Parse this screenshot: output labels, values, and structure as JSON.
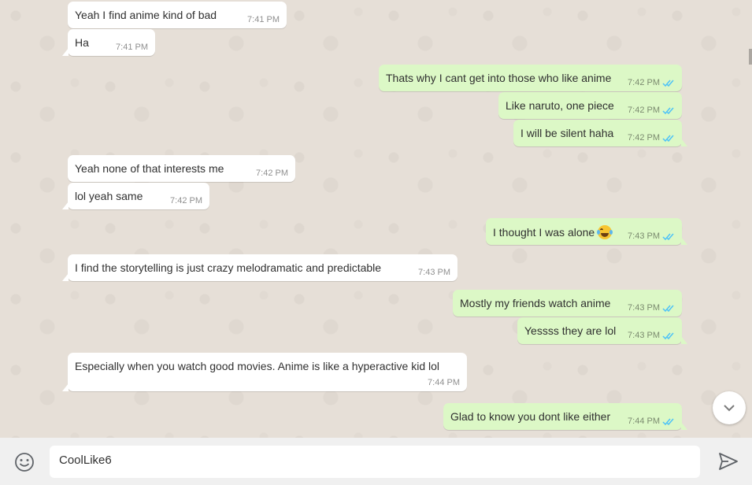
{
  "messages": [
    {
      "dir": "in",
      "text": "Yeah I find anime kind of bad",
      "time": "7:41 PM"
    },
    {
      "dir": "in",
      "text": "Ha",
      "time": "7:41 PM"
    },
    {
      "dir": "out",
      "text": "Thats why I cant get into those who like anime",
      "time": "7:42 PM",
      "status": "read"
    },
    {
      "dir": "out",
      "text": "Like naruto, one piece",
      "time": "7:42 PM",
      "status": "read"
    },
    {
      "dir": "out",
      "text": "I will be silent haha",
      "time": "7:42 PM",
      "status": "read"
    },
    {
      "dir": "in",
      "text": "Yeah none of that interests me",
      "time": "7:42 PM"
    },
    {
      "dir": "in",
      "text": "lol yeah same",
      "time": "7:42 PM"
    },
    {
      "dir": "out",
      "text": "I thought I was alone",
      "emoji": "face-with-tears-of-joy",
      "time": "7:43 PM",
      "status": "read"
    },
    {
      "dir": "in",
      "text": "I find the storytelling is just crazy melodramatic and predictable",
      "time": "7:43 PM"
    },
    {
      "dir": "out",
      "text": "Mostly my friends watch anime",
      "time": "7:43 PM",
      "status": "read"
    },
    {
      "dir": "out",
      "text": "Yessss they are lol",
      "time": "7:43 PM",
      "status": "read"
    },
    {
      "dir": "in",
      "text": "Especially when you watch good movies. Anime is like a hyperactive kid lol",
      "time": "7:44 PM"
    },
    {
      "dir": "out",
      "text": "Glad to know you dont like either",
      "time": "7:44 PM",
      "status": "read"
    }
  ],
  "composer": {
    "value": "CoolLike6",
    "emoji_icon": "smiley-icon",
    "send_icon": "send-icon"
  },
  "colors": {
    "incoming": "#ffffff",
    "outgoing": "#dcf8c6",
    "read_ticks": "#4fc3f7",
    "background": "#e6dfd7"
  }
}
